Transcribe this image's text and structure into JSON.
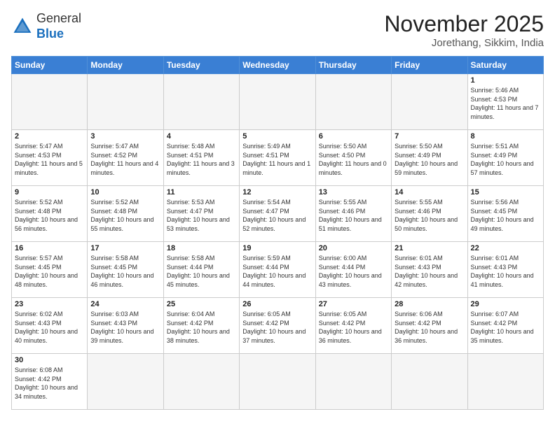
{
  "header": {
    "logo_general": "General",
    "logo_blue": "Blue",
    "title": "November 2025",
    "subtitle": "Jorethang, Sikkim, India"
  },
  "weekdays": [
    "Sunday",
    "Monday",
    "Tuesday",
    "Wednesday",
    "Thursday",
    "Friday",
    "Saturday"
  ],
  "weeks": [
    [
      {
        "day": "",
        "info": ""
      },
      {
        "day": "",
        "info": ""
      },
      {
        "day": "",
        "info": ""
      },
      {
        "day": "",
        "info": ""
      },
      {
        "day": "",
        "info": ""
      },
      {
        "day": "",
        "info": ""
      },
      {
        "day": "1",
        "info": "Sunrise: 5:46 AM\nSunset: 4:53 PM\nDaylight: 11 hours and 7 minutes."
      }
    ],
    [
      {
        "day": "2",
        "info": "Sunrise: 5:47 AM\nSunset: 4:53 PM\nDaylight: 11 hours and 5 minutes."
      },
      {
        "day": "3",
        "info": "Sunrise: 5:47 AM\nSunset: 4:52 PM\nDaylight: 11 hours and 4 minutes."
      },
      {
        "day": "4",
        "info": "Sunrise: 5:48 AM\nSunset: 4:51 PM\nDaylight: 11 hours and 3 minutes."
      },
      {
        "day": "5",
        "info": "Sunrise: 5:49 AM\nSunset: 4:51 PM\nDaylight: 11 hours and 1 minute."
      },
      {
        "day": "6",
        "info": "Sunrise: 5:50 AM\nSunset: 4:50 PM\nDaylight: 11 hours and 0 minutes."
      },
      {
        "day": "7",
        "info": "Sunrise: 5:50 AM\nSunset: 4:49 PM\nDaylight: 10 hours and 59 minutes."
      },
      {
        "day": "8",
        "info": "Sunrise: 5:51 AM\nSunset: 4:49 PM\nDaylight: 10 hours and 57 minutes."
      }
    ],
    [
      {
        "day": "9",
        "info": "Sunrise: 5:52 AM\nSunset: 4:48 PM\nDaylight: 10 hours and 56 minutes."
      },
      {
        "day": "10",
        "info": "Sunrise: 5:52 AM\nSunset: 4:48 PM\nDaylight: 10 hours and 55 minutes."
      },
      {
        "day": "11",
        "info": "Sunrise: 5:53 AM\nSunset: 4:47 PM\nDaylight: 10 hours and 53 minutes."
      },
      {
        "day": "12",
        "info": "Sunrise: 5:54 AM\nSunset: 4:47 PM\nDaylight: 10 hours and 52 minutes."
      },
      {
        "day": "13",
        "info": "Sunrise: 5:55 AM\nSunset: 4:46 PM\nDaylight: 10 hours and 51 minutes."
      },
      {
        "day": "14",
        "info": "Sunrise: 5:55 AM\nSunset: 4:46 PM\nDaylight: 10 hours and 50 minutes."
      },
      {
        "day": "15",
        "info": "Sunrise: 5:56 AM\nSunset: 4:45 PM\nDaylight: 10 hours and 49 minutes."
      }
    ],
    [
      {
        "day": "16",
        "info": "Sunrise: 5:57 AM\nSunset: 4:45 PM\nDaylight: 10 hours and 48 minutes."
      },
      {
        "day": "17",
        "info": "Sunrise: 5:58 AM\nSunset: 4:45 PM\nDaylight: 10 hours and 46 minutes."
      },
      {
        "day": "18",
        "info": "Sunrise: 5:58 AM\nSunset: 4:44 PM\nDaylight: 10 hours and 45 minutes."
      },
      {
        "day": "19",
        "info": "Sunrise: 5:59 AM\nSunset: 4:44 PM\nDaylight: 10 hours and 44 minutes."
      },
      {
        "day": "20",
        "info": "Sunrise: 6:00 AM\nSunset: 4:44 PM\nDaylight: 10 hours and 43 minutes."
      },
      {
        "day": "21",
        "info": "Sunrise: 6:01 AM\nSunset: 4:43 PM\nDaylight: 10 hours and 42 minutes."
      },
      {
        "day": "22",
        "info": "Sunrise: 6:01 AM\nSunset: 4:43 PM\nDaylight: 10 hours and 41 minutes."
      }
    ],
    [
      {
        "day": "23",
        "info": "Sunrise: 6:02 AM\nSunset: 4:43 PM\nDaylight: 10 hours and 40 minutes."
      },
      {
        "day": "24",
        "info": "Sunrise: 6:03 AM\nSunset: 4:43 PM\nDaylight: 10 hours and 39 minutes."
      },
      {
        "day": "25",
        "info": "Sunrise: 6:04 AM\nSunset: 4:42 PM\nDaylight: 10 hours and 38 minutes."
      },
      {
        "day": "26",
        "info": "Sunrise: 6:05 AM\nSunset: 4:42 PM\nDaylight: 10 hours and 37 minutes."
      },
      {
        "day": "27",
        "info": "Sunrise: 6:05 AM\nSunset: 4:42 PM\nDaylight: 10 hours and 36 minutes."
      },
      {
        "day": "28",
        "info": "Sunrise: 6:06 AM\nSunset: 4:42 PM\nDaylight: 10 hours and 36 minutes."
      },
      {
        "day": "29",
        "info": "Sunrise: 6:07 AM\nSunset: 4:42 PM\nDaylight: 10 hours and 35 minutes."
      }
    ],
    [
      {
        "day": "30",
        "info": "Sunrise: 6:08 AM\nSunset: 4:42 PM\nDaylight: 10 hours and 34 minutes."
      },
      {
        "day": "",
        "info": ""
      },
      {
        "day": "",
        "info": ""
      },
      {
        "day": "",
        "info": ""
      },
      {
        "day": "",
        "info": ""
      },
      {
        "day": "",
        "info": ""
      },
      {
        "day": "",
        "info": ""
      }
    ]
  ]
}
